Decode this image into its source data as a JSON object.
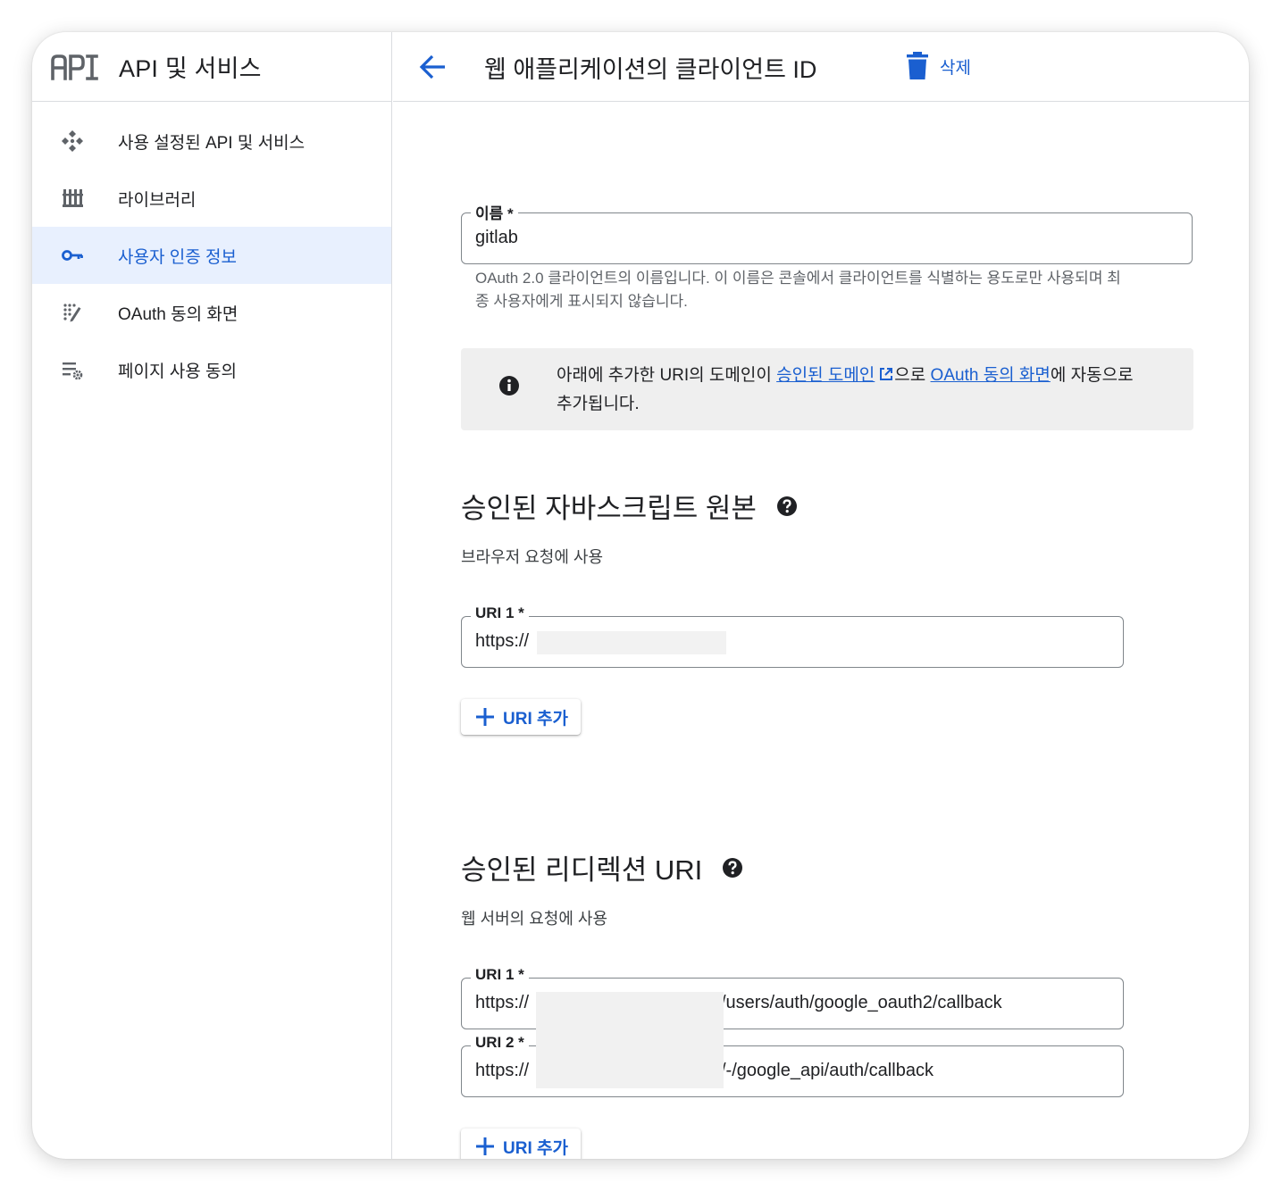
{
  "sidebar": {
    "logo_icon": "api-logo-icon",
    "title": "API 및 서비스",
    "items": [
      {
        "label": "사용 설정된 API 및 서비스",
        "icon": "enabled-apis-icon",
        "active": false
      },
      {
        "label": "라이브러리",
        "icon": "library-icon",
        "active": false
      },
      {
        "label": "사용자 인증 정보",
        "icon": "key-icon",
        "active": true
      },
      {
        "label": "OAuth 동의 화면",
        "icon": "oauth-consent-icon",
        "active": false
      },
      {
        "label": "페이지 사용 동의",
        "icon": "page-usage-settings-icon",
        "active": false
      }
    ]
  },
  "header": {
    "title": "웹 애플리케이션의 클라이언트 ID",
    "delete_label": "삭제"
  },
  "name_field": {
    "label": "이름 *",
    "value": "gitlab",
    "helper_line1": "OAuth 2.0 클라이언트의 이름입니다. 이 이름은 콘솔에서 클라이언트를 식별하는 용도로만 사용되며 최",
    "helper_line2": "종 사용자에게 표시되지 않습니다."
  },
  "info": {
    "text_before": "아래에 추가한 URI의 도메인이 ",
    "link1": "승인된 도메인",
    "text_middle": "으로 ",
    "link2": "OAuth 동의 화면",
    "text_after": "에 자동으로",
    "text_line2": "추가됩니다."
  },
  "js_origins": {
    "title": "승인된 자바스크립트 원본",
    "subtitle": "브라우저 요청에 사용",
    "uris": [
      {
        "label": "URI 1 *",
        "value_prefix": "https://",
        "value_suffix": ""
      }
    ],
    "add_label": "URI 추가"
  },
  "redirect_uris": {
    "title": "승인된 리디렉션 URI",
    "subtitle": "웹 서버의 요청에 사용",
    "uris": [
      {
        "label": "URI 1 *",
        "value_prefix": "https://",
        "value_suffix": "/users/auth/google_oauth2/callback"
      },
      {
        "label": "URI 2 *",
        "value_prefix": "https://",
        "value_suffix": "/-/google_api/auth/callback"
      }
    ],
    "add_label": "URI 추가"
  },
  "colors": {
    "accent": "#1a5fd0",
    "active_bg": "#e8f0fe",
    "border": "#dadce0",
    "info_bg": "#efefef"
  }
}
